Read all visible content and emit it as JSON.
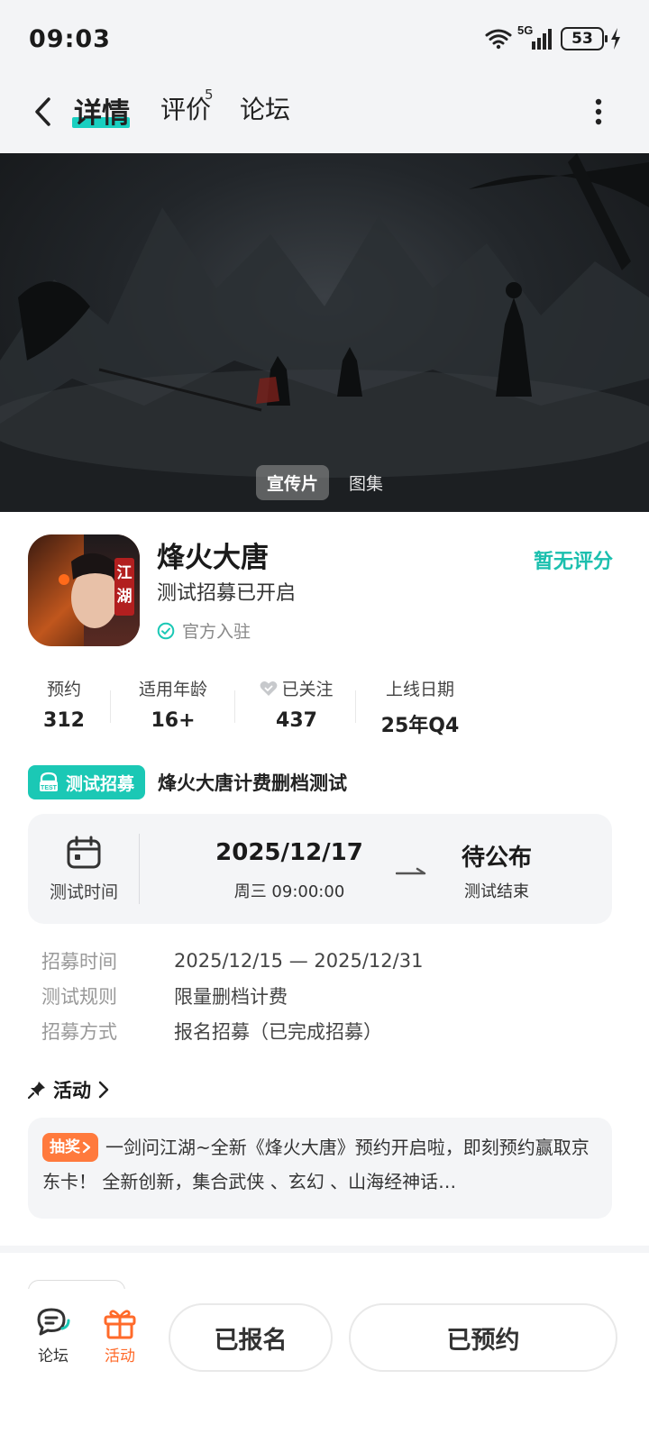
{
  "status_bar": {
    "time": "09:03",
    "network": "5G",
    "battery": "53"
  },
  "nav": {
    "tabs": [
      {
        "label": "详情",
        "active": true
      },
      {
        "label": "评价",
        "badge": "5"
      },
      {
        "label": "论坛"
      }
    ]
  },
  "banner": {
    "media_tabs": [
      "宣传片",
      "图集"
    ]
  },
  "game": {
    "name": "烽火大唐",
    "status": "测试招募已开启",
    "official": "官方入驻",
    "rating": "暂无评分",
    "icon_text": "江湖",
    "stats": [
      {
        "label": "预约",
        "value": "312"
      },
      {
        "label": "适用年龄",
        "value": "16+"
      },
      {
        "label": "已关注",
        "value": "437"
      },
      {
        "label": "上线日期",
        "value": "25年Q4"
      }
    ]
  },
  "recruit": {
    "badge": "测试招募",
    "title": "烽火大唐计费删档测试",
    "test_time_label": "测试时间",
    "start_date": "2025/12/17",
    "start_sub": "周三  09:00:00",
    "end_date": "待公布",
    "end_sub": "测试结束",
    "details": [
      {
        "key": "招募时间",
        "value": "2025/12/15 — 2025/12/31"
      },
      {
        "key": "测试规则",
        "value": "限量删档计费"
      },
      {
        "key": "招募方式",
        "value": "报名招募（已完成招募）"
      }
    ]
  },
  "activity": {
    "heading": "活动",
    "tag": "抽奖",
    "text": "一剑问江湖~全新《烽火大唐》预约开启啦，即刻预约赢取京东卡！ 全新创新，集合武侠 、玄幻 、山海经神话…"
  },
  "bottom_bar": {
    "forum_label": "论坛",
    "activity_label": "活动",
    "signed_label": "已报名",
    "reserved_label": "已预约"
  },
  "colors": {
    "accent": "#1bc8b5",
    "orange": "#ff7a3d"
  }
}
